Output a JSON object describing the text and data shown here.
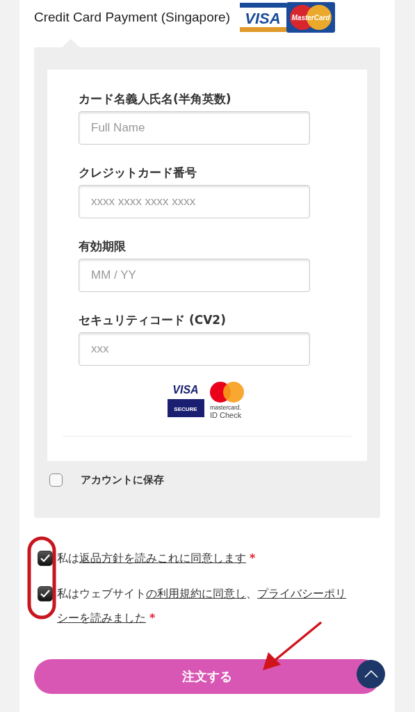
{
  "header": {
    "title": "Credit Card Payment (Singapore)",
    "card_logos": [
      "VISA",
      "MasterCard"
    ]
  },
  "card_form": {
    "fields": [
      {
        "label": "カード名義人氏名(半角英数)",
        "placeholder": "Full Name"
      },
      {
        "label": "クレジットカード番号",
        "placeholder": "xxxx xxxx xxxx xxxx"
      },
      {
        "label": "有効期限",
        "placeholder": "MM / YY"
      },
      {
        "label": "セキュリティコード (CV2)",
        "placeholder": "xxx"
      }
    ],
    "secure_badges": {
      "visa": "VISA",
      "visa_sub": "SECURE",
      "mc_name": "mastercard.",
      "mc_sub": "ID Check"
    }
  },
  "save_account": {
    "label": "アカウントに保存",
    "checked": false
  },
  "agreements": [
    {
      "checked": true,
      "lines": [
        [
          {
            "text": "私は",
            "link": false
          },
          {
            "text": "返品方針を読みこれに同意します",
            "link": true
          }
        ]
      ],
      "required": "*"
    },
    {
      "checked": true,
      "lines": [
        [
          {
            "text": "私はウェブサイト",
            "link": false
          },
          {
            "text": "の利用規約に同意し",
            "link": true
          },
          {
            "text": "、",
            "link": false
          },
          {
            "text": "プライバシーポリ",
            "link": true
          }
        ],
        [
          {
            "text": "シーを読みました",
            "link": true
          }
        ]
      ],
      "required": "*"
    }
  ],
  "order_button": "注文する"
}
